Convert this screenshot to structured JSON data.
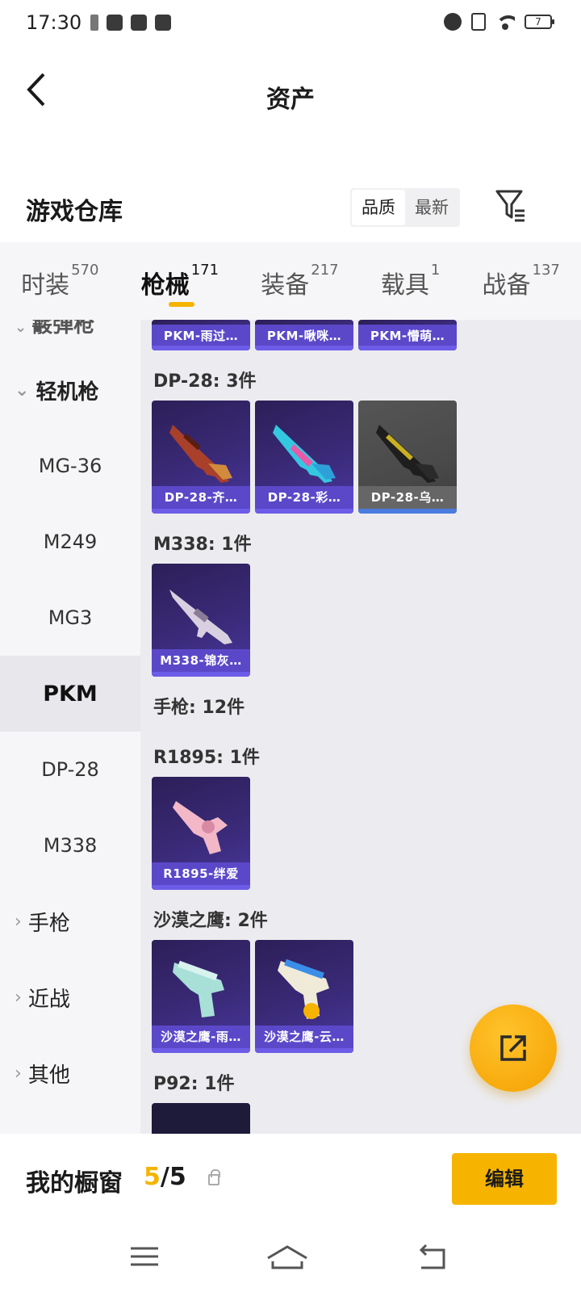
{
  "status_bar": {
    "time": "17:30",
    "battery": "7"
  },
  "header": {
    "title": "资产"
  },
  "warehouse": {
    "title": "游戏仓库",
    "sort_options": [
      "品质",
      "最新"
    ],
    "active_sort": "品质"
  },
  "tabs": [
    {
      "label": "时装",
      "count": "570"
    },
    {
      "label": "枪械",
      "count": "171",
      "active": true
    },
    {
      "label": "装备",
      "count": "217"
    },
    {
      "label": "载具",
      "count": "1"
    },
    {
      "label": "战备",
      "count": "137"
    }
  ],
  "sidebar": {
    "partial_label": "霰弹枪",
    "group_lmg": "轻机枪",
    "items": [
      "MG-36",
      "M249",
      "MG3",
      "PKM",
      "DP-28",
      "M338"
    ],
    "active_item": "PKM",
    "group_pistol": "手枪",
    "group_melee": "近战",
    "group_other": "其他"
  },
  "content": {
    "pkm_cards": [
      "PKM-雨过…",
      "PKM-啾咪…",
      "PKM-懵萌…"
    ],
    "dp28_title": "DP-28: 3件",
    "dp28_cards": [
      "DP-28-齐…",
      "DP-28-彩…",
      "DP-28-乌…"
    ],
    "m338_title": "M338: 1件",
    "m338_cards": [
      "M338-锦灰…"
    ],
    "pistol_title": "手枪: 12件",
    "r1895_title": "R1895: 1件",
    "r1895_cards": [
      "R1895-绊爱"
    ],
    "deagle_title": "沙漠之鹰: 2件",
    "deagle_cards": [
      "沙漠之鹰-雨…",
      "沙漠之鹰-云…"
    ],
    "p92_title": "P92: 1件"
  },
  "showcase": {
    "title": "我的橱窗",
    "current": "5",
    "total": "/5",
    "edit_label": "编辑"
  },
  "colors": {
    "accent": "#f4b400",
    "card_purple": "#5b48c9"
  }
}
